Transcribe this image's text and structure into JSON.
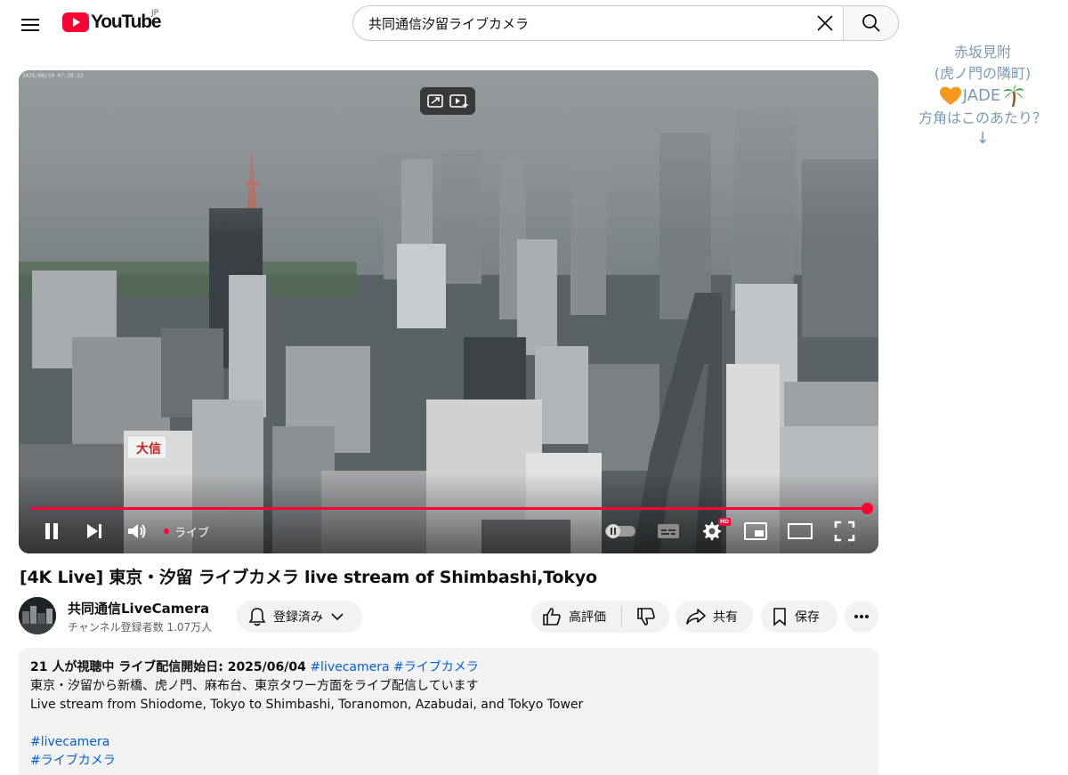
{
  "header": {
    "logo_text": "YouTube",
    "logo_country": "JP",
    "search_value": "共同通信汐留ライブカメラ"
  },
  "note": {
    "line1": "赤坂見附",
    "line2": "(虎ノ門の隣町)",
    "jade": "JADE",
    "line4": "方角はこのあたり？",
    "arrow": "↓"
  },
  "player": {
    "timestamp": "2025/06/10 07:26:22",
    "live_label": "ライブ",
    "hd_label": "HD",
    "progress": 1.0,
    "sign_text": "大信"
  },
  "video": {
    "title": "[4K Live] 東京・汐留 ライブカメラ live stream of Shimbashi,Tokyo"
  },
  "channel": {
    "name": "共同通信LiveCamera",
    "subscribers": "チャンネル登録者数 1.07万人",
    "subscribe_label": "登録済み"
  },
  "actions": {
    "like_label": "高評価",
    "share_label": "共有",
    "save_label": "保存"
  },
  "description": {
    "meta_text": "21 人が視聴中  ライブ配信開始日: 2025/06/04",
    "meta_tags": "#livecamera #ライブカメラ",
    "line_jp": "東京・汐留から新橋、虎ノ門、麻布台、東京タワー方面をライブ配信しています",
    "line_en": "Live stream from Shiodome, Tokyo to Shimbashi, Toranomon, Azabudai, and Tokyo Tower",
    "tag1": "#livecamera",
    "tag2": "#ライブカメラ"
  },
  "colors": {
    "brand_red": "#ff0033",
    "link_blue": "#065fd4",
    "note_blue": "#7b9ab5"
  }
}
